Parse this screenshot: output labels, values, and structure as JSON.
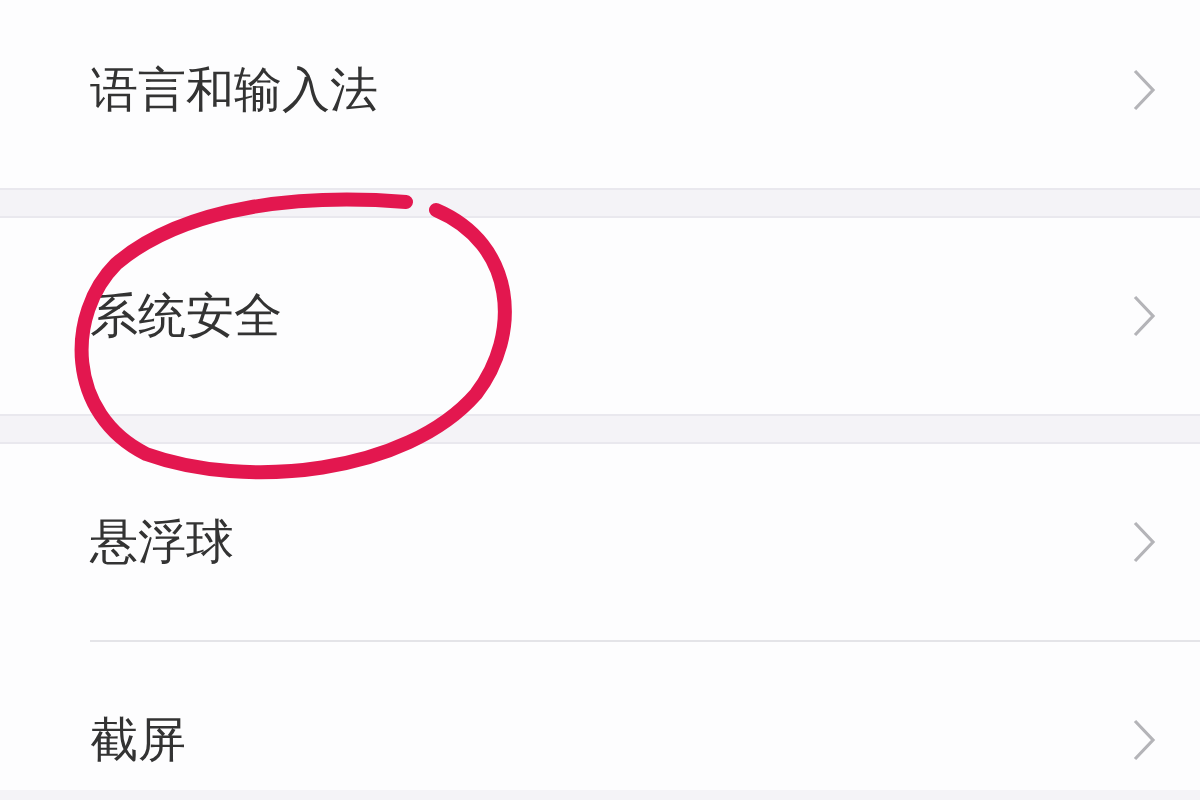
{
  "groups": [
    {
      "items": [
        {
          "label": "语言和输入法",
          "circled": false
        }
      ]
    },
    {
      "items": [
        {
          "label": "系统安全",
          "circled": true
        }
      ]
    },
    {
      "items": [
        {
          "label": "悬浮球",
          "circled": false
        },
        {
          "label": "截屏",
          "circled": false
        }
      ]
    }
  ]
}
